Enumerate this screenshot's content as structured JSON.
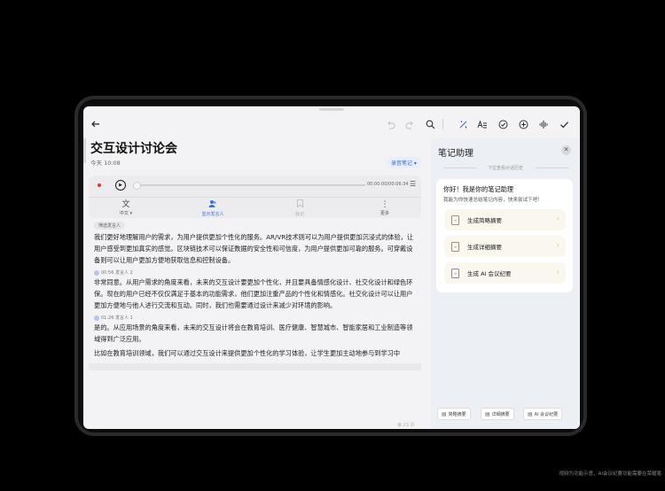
{
  "toolbar": {
    "back_icon": "arrow-left-icon",
    "undo_icon": "undo-icon",
    "redo_icon": "redo-icon",
    "search_icon": "search-icon",
    "ai_icon": "ai-magic-icon",
    "format_icon": "text-format-icon",
    "check_circle_icon": "check-circle-icon",
    "add_icon": "add-circle-icon",
    "audio_icon": "audio-wave-icon",
    "done_icon": "check-icon"
  },
  "note": {
    "title": "交互设计讨论会",
    "date": "今天 10:08",
    "tag": "录音笔记 ▾"
  },
  "recorder": {
    "time": "00:00:00/00:06:34",
    "controls": [
      {
        "label": "中文 ▾",
        "icon": "translate-icon",
        "glyph": "文"
      },
      {
        "label": "显示发言人",
        "icon": "speaker-person-icon",
        "glyph": "👥"
      },
      {
        "label": "标记",
        "icon": "bookmark-icon",
        "glyph": "⌑"
      },
      {
        "label": "更多",
        "icon": "more-vertical-icon",
        "glyph": "⋮"
      }
    ]
  },
  "transcript": {
    "filter_chip": "筛选发言人",
    "paragraphs": [
      "我们更好地理解用户的需求，为用户提供更加个性化的服务。AR/VR技术则可以为用户提供更加沉浸式的体验，让用户感受到更加真实的感觉。区块链技术可以保证数据的安全性和可信度，为用户提供更加可靠的服务。可穿戴设备则可以让用户更加方便地获取信息和控制设备。",
      "非常同意。从用户需求的角度来看，未来的交互设计要更加个性化，并且要具备情感化设计、社交化设计和绿色环保。现在的用户已经不仅仅满足于基本的功能需求，他们更加注重产品的个性化和情感化。社交化设计可以让用户更加方便地与他人进行交流和互动。同时，我们也需要通过设计来减少对环境的影响。",
      "是的。从应用场景的角度来看，未来的交互设计将会在教育培训、医疗健康、智慧城市、智能家居和工业制造等领域得到广泛应用。",
      "比如在教育培训领域，我们可以通过交互设计来提供更加个性化的学习体验，让学生更加主动地参与到学习中"
    ],
    "speaker_2": "00:56 发言人 2",
    "speaker_1": "01:26 发言人 1",
    "page_num": "第 23 页"
  },
  "assistant": {
    "title": "笔记助理",
    "hint": "下拉查看对话历史",
    "greeting": "你好！我是你的笔记助理",
    "greeting_sub": "我能为你快速总结笔记内容，快来尝试下吧！",
    "actions": [
      {
        "label": "生成简略摘要",
        "icon": "doc-short-icon"
      },
      {
        "label": "生成详细摘要",
        "icon": "doc-detail-icon"
      },
      {
        "label": "生成 AI 会议纪要",
        "icon": "ai-minutes-icon"
      }
    ],
    "bottom_buttons": [
      "简略摘要",
      "详细摘要",
      "AI 会议纪要"
    ]
  },
  "footer": {
    "disclaimer": "视频为功能示意，AI会议纪要功能需要在荣耀笔"
  }
}
